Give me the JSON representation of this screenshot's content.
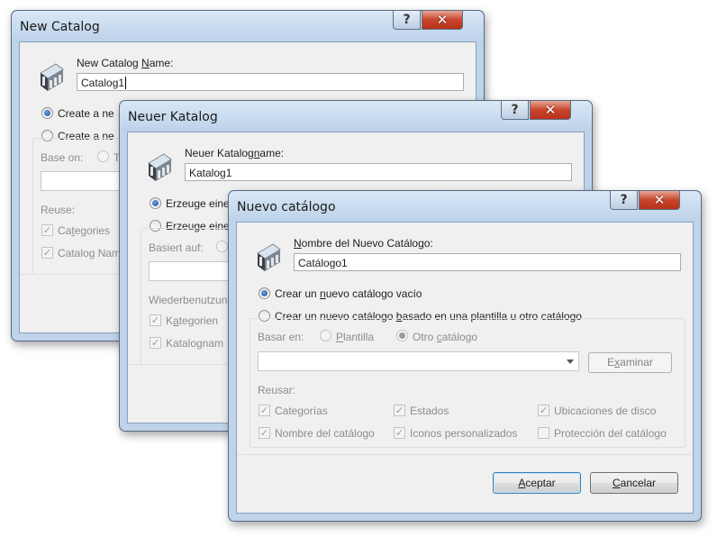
{
  "windows": {
    "en": {
      "title": "New Catalog",
      "help_glyph": "?",
      "close_glyph": "✕",
      "name_label_before": "New Catalog ",
      "name_label_underlined": "N",
      "name_label_after": "ame:",
      "name_value": "Catalog1",
      "radio_empty_visible": "Create a ne",
      "radio_template_visible": "Create a ne",
      "base_on_label": "Base on:",
      "base_on_option_visible": "T",
      "reuse_label": "Reuse:",
      "reuse_categories_before": "Ca",
      "reuse_categories_underlined": "t",
      "reuse_categories_after": "egories",
      "reuse_catalog_name_visible": "Catalog Nam"
    },
    "de": {
      "title": "Neuer Katalog",
      "help_glyph": "?",
      "close_glyph": "✕",
      "name_label_before": "Neuer Katalog",
      "name_label_underlined": "n",
      "name_label_after": "ame:",
      "name_value": "Katalog1",
      "radio_empty_visible": "Erzeuge eine",
      "radio_template_visible": "Erzeuge eine",
      "base_on_label": "Basiert auf:",
      "reuse_label": "Wiederbenutzun",
      "reuse_categories_before": "K",
      "reuse_categories_underlined": "a",
      "reuse_categories_after": "tegorien",
      "reuse_catalog_name_visible": "Katalognam"
    },
    "es": {
      "title": "Nuevo catálogo",
      "help_glyph": "?",
      "close_glyph": "✕",
      "name_label_before": "",
      "name_label_underlined": "N",
      "name_label_after": "ombre del Nuevo Catálogo:",
      "name_value": "Catálogo1",
      "radio_empty_before": "Crear un ",
      "radio_empty_underlined": "n",
      "radio_empty_after": "uevo catálogo vacío",
      "radio_template_before": "Crear un nuevo catálogo ",
      "radio_template_underlined": "b",
      "radio_template_after": "asado en una plantilla u otro catálogo",
      "base_on_label": "Basar en:",
      "option_template_before": "",
      "option_template_underlined": "P",
      "option_template_after": "lantilla",
      "option_other_before": "Otro ",
      "option_other_underlined": "c",
      "option_other_after": "atálogo",
      "browse_before": "E",
      "browse_underlined": "x",
      "browse_after": "aminar",
      "reuse_label": "Reusar:",
      "reuse": {
        "categorias": "Categorías",
        "estados": "Estados",
        "ubicaciones": "Ubicaciones de disco",
        "nombre": "Nombre del catálogo",
        "iconos": "Iconos personalizados",
        "proteccion": "Protección del catálogo"
      },
      "ok_before": "",
      "ok_underlined": "A",
      "ok_after": "ceptar",
      "cancel_before": "",
      "cancel_underlined": "C",
      "cancel_after": "ancelar"
    }
  }
}
